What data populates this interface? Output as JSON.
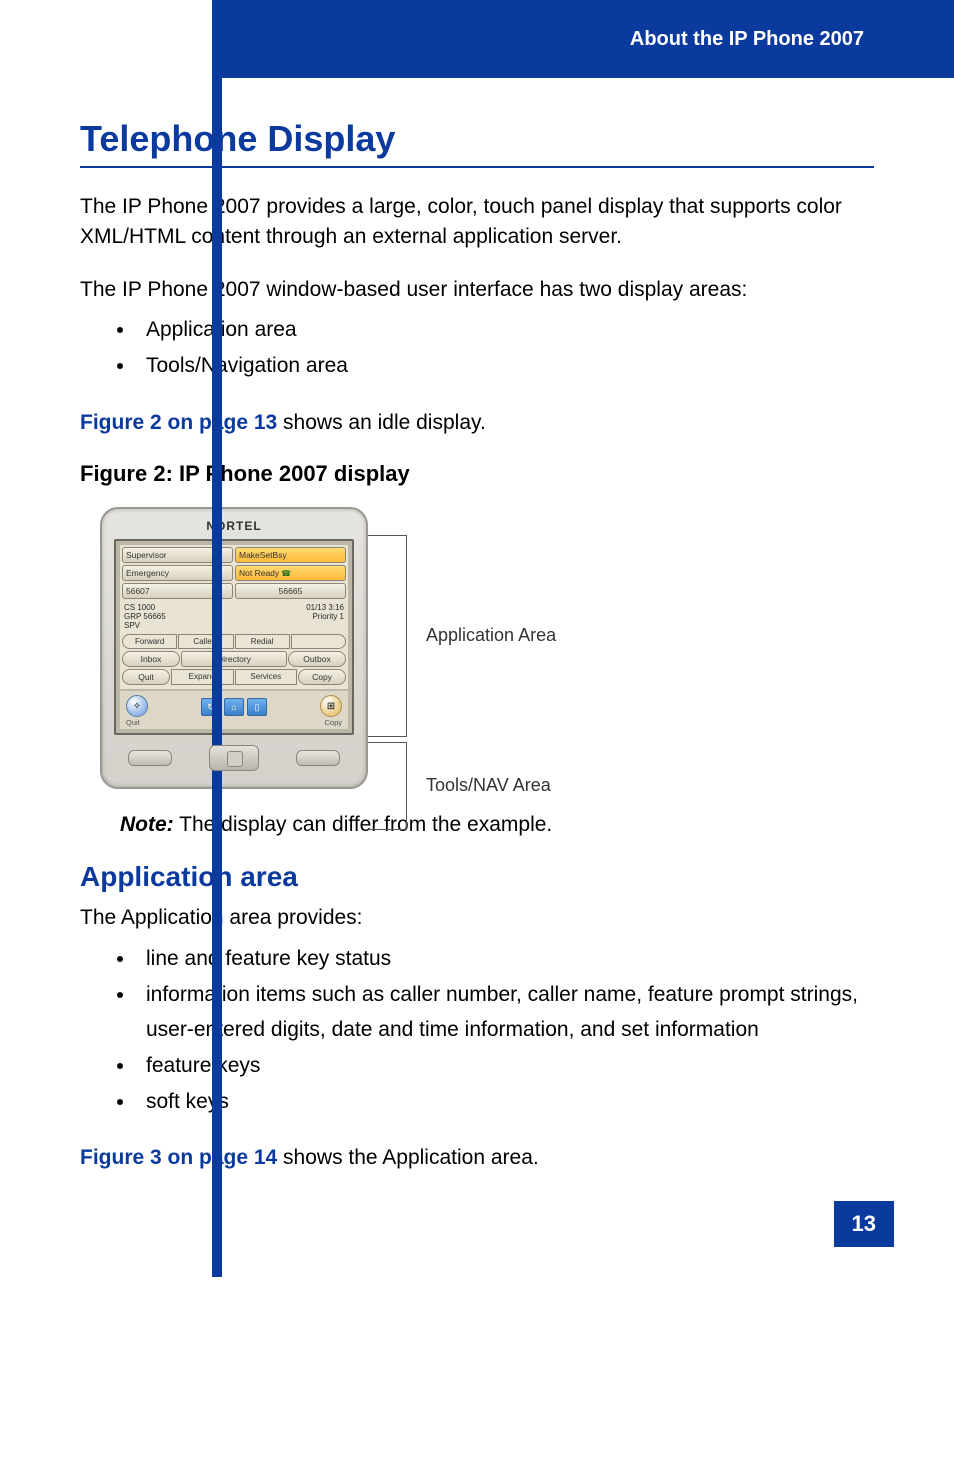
{
  "header": {
    "title": "About the IP Phone 2007"
  },
  "page_number": "13",
  "section": {
    "title": "Telephone Display",
    "para1": "The IP Phone 2007 provides a large, color, touch panel display that supports color XML/HTML content through an external application server.",
    "para2": "The IP Phone 2007 window-based user interface has two display areas:",
    "bullets1": [
      "Application area",
      "Tools/Navigation area"
    ],
    "xref1_link": "Figure 2 on page 13",
    "xref1_rest": " shows an idle display.",
    "fig_caption": "Figure 2: IP Phone 2007 display",
    "note_label": "Note:",
    "note_text": " The display can differ from the example.",
    "subsection_title": "Application area",
    "para3": "The Application area provides:",
    "bullets2": [
      "line and feature key status",
      "information items such as caller number, caller name, feature prompt strings, user-entered digits, date and time information, and set information",
      "feature keys",
      "soft keys"
    ],
    "xref2_link": "Figure 3 on page 14",
    "xref2_rest": " shows the Application area."
  },
  "figure": {
    "brand": "NORTEL",
    "keys_r1": [
      "Supervisor",
      "MakeSetBsy"
    ],
    "keys_r2": [
      "Emergency",
      "Not Ready"
    ],
    "keys_r3": [
      "56607",
      "56665"
    ],
    "info_left": "CS 1000\nGRP 56665\nSPV",
    "info_right_top": "01/13 3:16",
    "info_right_bot": "Priority 1",
    "soft_r1": [
      "Forward",
      "Callers",
      "Redial",
      ""
    ],
    "soft_r2": [
      "Inbox",
      "Directory",
      "Outbox"
    ],
    "soft_r3": [
      "Quit",
      "Expand",
      "Services",
      "Copy"
    ],
    "tool_left": "Quit",
    "tool_right": "Copy",
    "callout_app": "Application Area",
    "callout_tools": "Tools/NAV Area"
  }
}
